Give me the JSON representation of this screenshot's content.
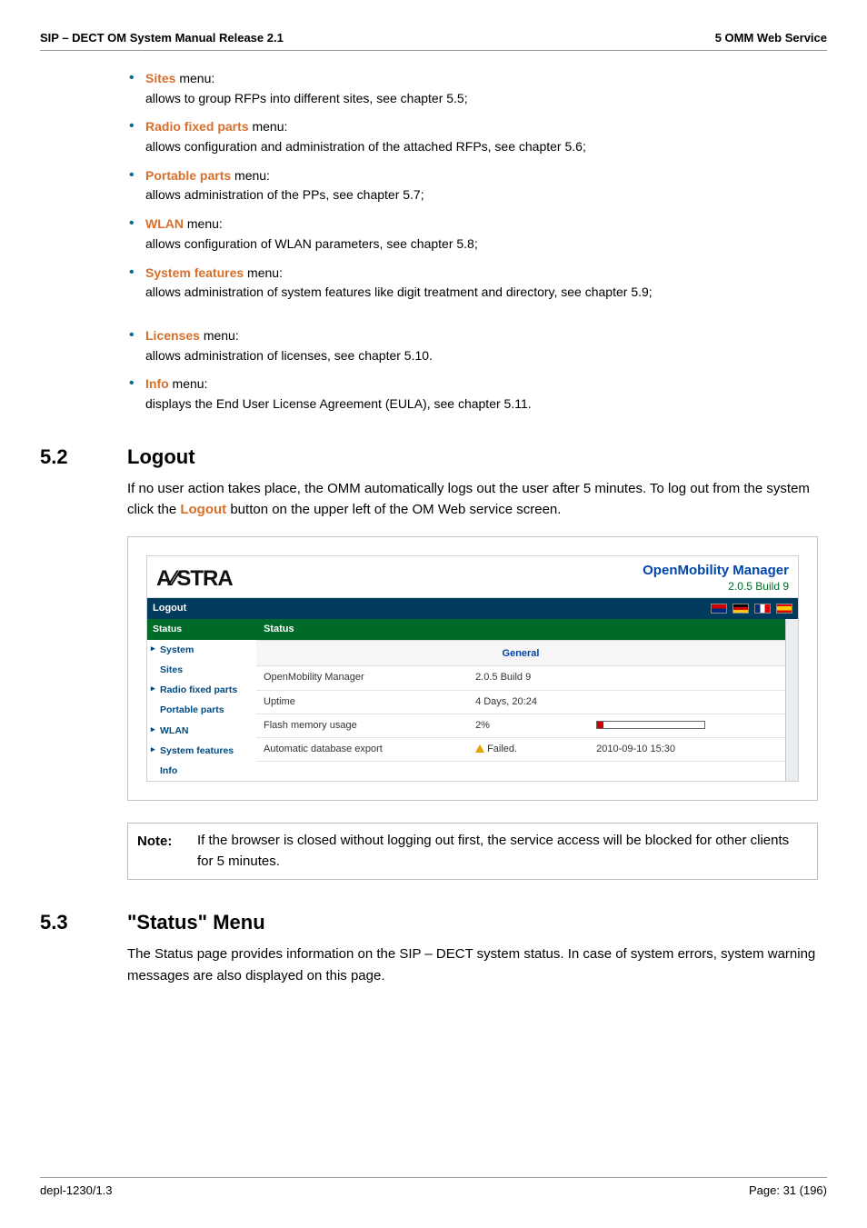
{
  "header": {
    "left": "SIP – DECT OM System Manual Release 2.1",
    "right": "5 OMM Web Service"
  },
  "bullets": [
    {
      "term": "Sites",
      "after": " menu:",
      "body": "allows to group RFPs into different sites, see chapter 5.5;"
    },
    {
      "term": "Radio fixed parts",
      "after": " menu:",
      "body": "allows configuration and administration of the attached RFPs, see chapter 5.6;"
    },
    {
      "term": "Portable parts",
      "after": " menu:",
      "body": "allows administration of the PPs, see chapter 5.7;"
    },
    {
      "term": "WLAN",
      "after": " menu:",
      "body": "allows configuration of WLAN parameters, see chapter 5.8;"
    },
    {
      "term": "System features",
      "after": " menu:",
      "body": "allows administration of system features like digit treatment and directory, see chapter 5.9;"
    }
  ],
  "bullets2": [
    {
      "term": "Licenses",
      "after": " menu:",
      "body": "allows administration of licenses, see chapter 5.10."
    },
    {
      "term": "Info",
      "after": " menu:",
      "body": "displays the End User License Agreement (EULA), see chapter 5.11."
    }
  ],
  "sec52": {
    "num": "5.2",
    "title": "Logout",
    "body_a": "If no user action takes place, the OMM automatically logs out the user after 5 minutes. To log out from the system click the ",
    "body_link": "Logout",
    "body_b": " button on the upper left of the OM Web service screen."
  },
  "shot": {
    "brand": "A∕∕STRA",
    "omm": "OpenMobility Manager",
    "omm_ver": "2.0.5 Build 9",
    "logout": "Logout",
    "nav": {
      "status": "Status",
      "system": "System",
      "sites": "Sites",
      "rfp": "Radio fixed parts",
      "pp": "Portable parts",
      "wlan": "WLAN",
      "sf": "System features",
      "info": "Info"
    },
    "main_title": "Status",
    "section": "General",
    "rows": [
      {
        "k": "OpenMobility Manager",
        "v": "2.0.5 Build 9",
        "extra": ""
      },
      {
        "k": "Uptime",
        "v": "4 Days, 20:24",
        "extra": ""
      },
      {
        "k": "Flash memory usage",
        "v": "2%",
        "extra": "progress"
      },
      {
        "k": "Automatic database export",
        "v": "Failed.",
        "warn": true,
        "extra": "2010-09-10 15:30"
      }
    ]
  },
  "note": {
    "label": "Note:",
    "text": "If the browser is closed without logging out first, the service access will be blocked for other clients for 5 minutes."
  },
  "sec53": {
    "num": "5.3",
    "title": "\"Status\" Menu",
    "body": "The Status page provides information on the SIP – DECT system status. In case of system errors, system warning messages are also displayed on this page."
  },
  "footer": {
    "left": "depl-1230/1.3",
    "right": "Page: 31 (196)"
  }
}
